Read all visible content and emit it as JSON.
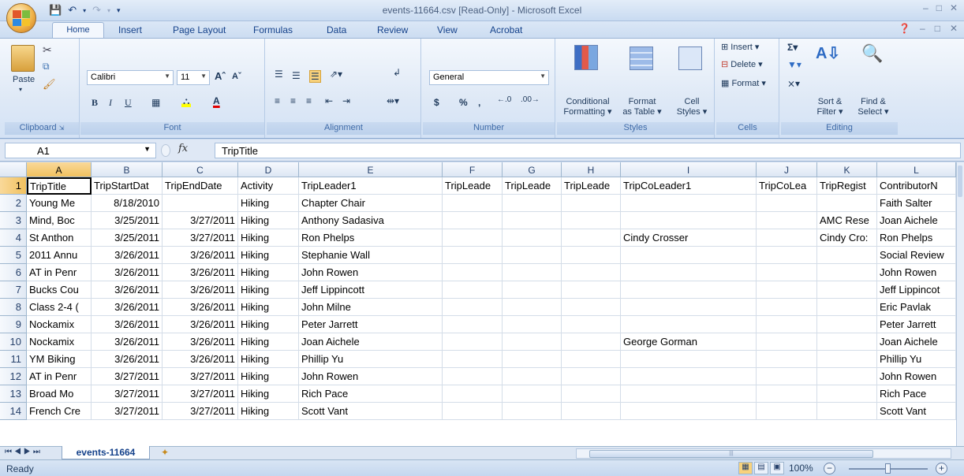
{
  "window": {
    "title": "events-11664.csv [Read-Only] - Microsoft Excel"
  },
  "ribbon_tabs": [
    "Home",
    "Insert",
    "Page Layout",
    "Formulas",
    "Data",
    "Review",
    "View",
    "Acrobat"
  ],
  "ribbon": {
    "clipboard": {
      "paste": "Paste",
      "label": "Clipboard"
    },
    "font": {
      "name": "Calibri",
      "size": "11",
      "label": "Font",
      "bold": "B",
      "italic": "I",
      "underline": "U"
    },
    "alignment": {
      "label": "Alignment"
    },
    "number": {
      "format": "General",
      "label": "Number",
      "currency": "$",
      "percent": "%",
      "comma": ","
    },
    "styles": {
      "conditional": "Conditional",
      "conditional2": "Formatting",
      "format_table": "Format",
      "format_table2": "as Table",
      "cell_styles": "Cell",
      "cell_styles2": "Styles",
      "label": "Styles"
    },
    "cells": {
      "insert": "Insert",
      "delete": "Delete",
      "format": "Format",
      "label": "Cells"
    },
    "editing": {
      "sort": "Sort &",
      "sort2": "Filter",
      "find": "Find &",
      "find2": "Select",
      "label": "Editing"
    }
  },
  "formula_bar": {
    "name_box": "A1",
    "fx": "fx",
    "formula": "TripTitle"
  },
  "columns": [
    {
      "letter": "A",
      "width": 82
    },
    {
      "letter": "B",
      "width": 90
    },
    {
      "letter": "C",
      "width": 96
    },
    {
      "letter": "D",
      "width": 77
    },
    {
      "letter": "E",
      "width": 182
    },
    {
      "letter": "F",
      "width": 76
    },
    {
      "letter": "G",
      "width": 75
    },
    {
      "letter": "H",
      "width": 75
    },
    {
      "letter": "I",
      "width": 172
    },
    {
      "letter": "J",
      "width": 77
    },
    {
      "letter": "K",
      "width": 76
    },
    {
      "letter": "L",
      "width": 100
    }
  ],
  "rows": [
    [
      "TripTitle",
      "TripStartDat",
      "TripEndDate",
      "Activity",
      "TripLeader1",
      "TripLeade",
      "TripLeade",
      "TripLeade",
      "TripCoLeader1",
      "TripCoLea",
      "TripRegist",
      "ContributorN"
    ],
    [
      "Young Me",
      "8/18/2010",
      "",
      "Hiking",
      "Chapter Chair",
      "",
      "",
      "",
      "",
      "",
      "",
      "Faith Salter"
    ],
    [
      "Mind, Boc",
      "3/25/2011",
      "3/27/2011",
      "Hiking",
      "Anthony Sadasiva",
      "",
      "",
      "",
      "",
      "",
      "AMC Rese",
      "Joan Aichele"
    ],
    [
      "St Anthon",
      "3/25/2011",
      "3/27/2011",
      "Hiking",
      "Ron Phelps",
      "",
      "",
      "",
      "Cindy Crosser",
      "",
      "Cindy Cro:",
      "Ron Phelps"
    ],
    [
      "2011 Annu",
      "3/26/2011",
      "3/26/2011",
      "Hiking",
      "Stephanie Wall",
      "",
      "",
      "",
      "",
      "",
      "",
      "Social Review"
    ],
    [
      "AT in Penr",
      "3/26/2011",
      "3/26/2011",
      "Hiking",
      "John Rowen",
      "",
      "",
      "",
      "",
      "",
      "",
      "John Rowen"
    ],
    [
      "Bucks Cou",
      "3/26/2011",
      "3/26/2011",
      "Hiking",
      "Jeff Lippincott",
      "",
      "",
      "",
      "",
      "",
      "",
      "Jeff Lippincot"
    ],
    [
      "Class 2-4 (",
      "3/26/2011",
      "3/26/2011",
      "Hiking",
      "John Milne",
      "",
      "",
      "",
      "",
      "",
      "",
      "Eric Pavlak"
    ],
    [
      "Nockamix",
      "3/26/2011",
      "3/26/2011",
      "Hiking",
      "Peter Jarrett",
      "",
      "",
      "",
      "",
      "",
      "",
      "Peter Jarrett"
    ],
    [
      "Nockamix",
      "3/26/2011",
      "3/26/2011",
      "Hiking",
      "Joan Aichele",
      "",
      "",
      "",
      "George Gorman",
      "",
      "",
      "Joan Aichele"
    ],
    [
      "YM Biking",
      "3/26/2011",
      "3/26/2011",
      "Hiking",
      "Phillip Yu",
      "",
      "",
      "",
      "",
      "",
      "",
      "Phillip Yu"
    ],
    [
      "AT in Penr",
      "3/27/2011",
      "3/27/2011",
      "Hiking",
      "John Rowen",
      "",
      "",
      "",
      "",
      "",
      "",
      "John Rowen"
    ],
    [
      "Broad Mo",
      "3/27/2011",
      "3/27/2011",
      "Hiking",
      "Rich Pace",
      "",
      "",
      "",
      "",
      "",
      "",
      "Rich Pace"
    ],
    [
      "French Cre",
      "3/27/2011",
      "3/27/2011",
      "Hiking",
      "Scott Vant",
      "",
      "",
      "",
      "",
      "",
      "",
      "Scott Vant"
    ]
  ],
  "sheet_tab": "events-11664",
  "status": {
    "text": "Ready",
    "zoom": "100%"
  }
}
